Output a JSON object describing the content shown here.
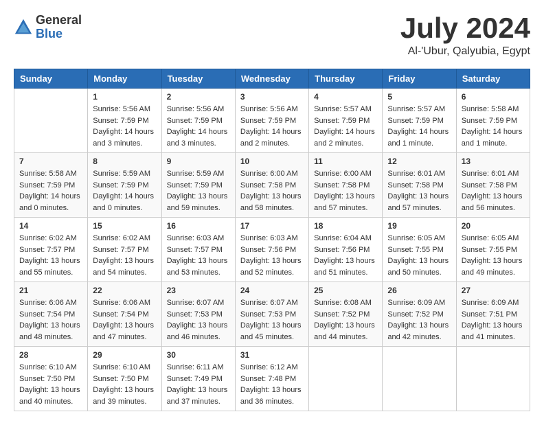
{
  "header": {
    "logo_general": "General",
    "logo_blue": "Blue",
    "month_title": "July 2024",
    "location": "Al-'Ubur, Qalyubia, Egypt"
  },
  "calendar": {
    "days_of_week": [
      "Sunday",
      "Monday",
      "Tuesday",
      "Wednesday",
      "Thursday",
      "Friday",
      "Saturday"
    ],
    "weeks": [
      [
        {
          "day": "",
          "info": ""
        },
        {
          "day": "1",
          "info": "Sunrise: 5:56 AM\nSunset: 7:59 PM\nDaylight: 14 hours\nand 3 minutes."
        },
        {
          "day": "2",
          "info": "Sunrise: 5:56 AM\nSunset: 7:59 PM\nDaylight: 14 hours\nand 3 minutes."
        },
        {
          "day": "3",
          "info": "Sunrise: 5:56 AM\nSunset: 7:59 PM\nDaylight: 14 hours\nand 2 minutes."
        },
        {
          "day": "4",
          "info": "Sunrise: 5:57 AM\nSunset: 7:59 PM\nDaylight: 14 hours\nand 2 minutes."
        },
        {
          "day": "5",
          "info": "Sunrise: 5:57 AM\nSunset: 7:59 PM\nDaylight: 14 hours\nand 1 minute."
        },
        {
          "day": "6",
          "info": "Sunrise: 5:58 AM\nSunset: 7:59 PM\nDaylight: 14 hours\nand 1 minute."
        }
      ],
      [
        {
          "day": "7",
          "info": "Sunrise: 5:58 AM\nSunset: 7:59 PM\nDaylight: 14 hours\nand 0 minutes."
        },
        {
          "day": "8",
          "info": "Sunrise: 5:59 AM\nSunset: 7:59 PM\nDaylight: 14 hours\nand 0 minutes."
        },
        {
          "day": "9",
          "info": "Sunrise: 5:59 AM\nSunset: 7:59 PM\nDaylight: 13 hours\nand 59 minutes."
        },
        {
          "day": "10",
          "info": "Sunrise: 6:00 AM\nSunset: 7:58 PM\nDaylight: 13 hours\nand 58 minutes."
        },
        {
          "day": "11",
          "info": "Sunrise: 6:00 AM\nSunset: 7:58 PM\nDaylight: 13 hours\nand 57 minutes."
        },
        {
          "day": "12",
          "info": "Sunrise: 6:01 AM\nSunset: 7:58 PM\nDaylight: 13 hours\nand 57 minutes."
        },
        {
          "day": "13",
          "info": "Sunrise: 6:01 AM\nSunset: 7:58 PM\nDaylight: 13 hours\nand 56 minutes."
        }
      ],
      [
        {
          "day": "14",
          "info": "Sunrise: 6:02 AM\nSunset: 7:57 PM\nDaylight: 13 hours\nand 55 minutes."
        },
        {
          "day": "15",
          "info": "Sunrise: 6:02 AM\nSunset: 7:57 PM\nDaylight: 13 hours\nand 54 minutes."
        },
        {
          "day": "16",
          "info": "Sunrise: 6:03 AM\nSunset: 7:57 PM\nDaylight: 13 hours\nand 53 minutes."
        },
        {
          "day": "17",
          "info": "Sunrise: 6:03 AM\nSunset: 7:56 PM\nDaylight: 13 hours\nand 52 minutes."
        },
        {
          "day": "18",
          "info": "Sunrise: 6:04 AM\nSunset: 7:56 PM\nDaylight: 13 hours\nand 51 minutes."
        },
        {
          "day": "19",
          "info": "Sunrise: 6:05 AM\nSunset: 7:55 PM\nDaylight: 13 hours\nand 50 minutes."
        },
        {
          "day": "20",
          "info": "Sunrise: 6:05 AM\nSunset: 7:55 PM\nDaylight: 13 hours\nand 49 minutes."
        }
      ],
      [
        {
          "day": "21",
          "info": "Sunrise: 6:06 AM\nSunset: 7:54 PM\nDaylight: 13 hours\nand 48 minutes."
        },
        {
          "day": "22",
          "info": "Sunrise: 6:06 AM\nSunset: 7:54 PM\nDaylight: 13 hours\nand 47 minutes."
        },
        {
          "day": "23",
          "info": "Sunrise: 6:07 AM\nSunset: 7:53 PM\nDaylight: 13 hours\nand 46 minutes."
        },
        {
          "day": "24",
          "info": "Sunrise: 6:07 AM\nSunset: 7:53 PM\nDaylight: 13 hours\nand 45 minutes."
        },
        {
          "day": "25",
          "info": "Sunrise: 6:08 AM\nSunset: 7:52 PM\nDaylight: 13 hours\nand 44 minutes."
        },
        {
          "day": "26",
          "info": "Sunrise: 6:09 AM\nSunset: 7:52 PM\nDaylight: 13 hours\nand 42 minutes."
        },
        {
          "day": "27",
          "info": "Sunrise: 6:09 AM\nSunset: 7:51 PM\nDaylight: 13 hours\nand 41 minutes."
        }
      ],
      [
        {
          "day": "28",
          "info": "Sunrise: 6:10 AM\nSunset: 7:50 PM\nDaylight: 13 hours\nand 40 minutes."
        },
        {
          "day": "29",
          "info": "Sunrise: 6:10 AM\nSunset: 7:50 PM\nDaylight: 13 hours\nand 39 minutes."
        },
        {
          "day": "30",
          "info": "Sunrise: 6:11 AM\nSunset: 7:49 PM\nDaylight: 13 hours\nand 37 minutes."
        },
        {
          "day": "31",
          "info": "Sunrise: 6:12 AM\nSunset: 7:48 PM\nDaylight: 13 hours\nand 36 minutes."
        },
        {
          "day": "",
          "info": ""
        },
        {
          "day": "",
          "info": ""
        },
        {
          "day": "",
          "info": ""
        }
      ]
    ]
  }
}
